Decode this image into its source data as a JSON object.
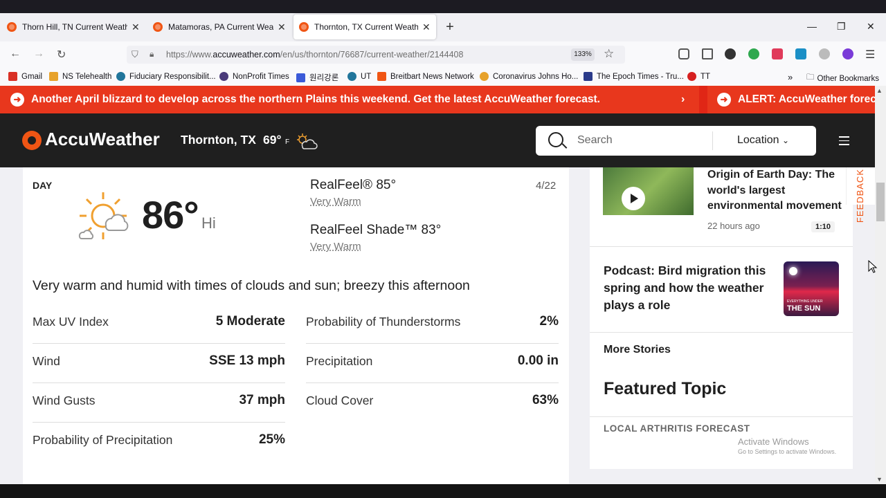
{
  "browser": {
    "tabs": [
      {
        "title": "Thorn Hill, TN Current Weather"
      },
      {
        "title": "Matamoras, PA Current Weather"
      },
      {
        "title": "Thornton, TX Current Weather | AccuWeather"
      }
    ],
    "url_prefix": "https://www.",
    "url_domain": "accuweather.com",
    "url_path": "/en/us/thornton/76687/current-weather/2144408",
    "zoom": "133%",
    "bookmarks": [
      "Gmail",
      "NS Telehealth",
      "Fiduciary Responsibilit...",
      "NonProfit Times",
      "원리강론",
      "UT",
      "Breitbart News Network",
      "Coronavirus Johns Ho...",
      "The Epoch Times - Tru...",
      "TT"
    ],
    "other_bookmarks": "Other Bookmarks"
  },
  "alerts": {
    "primary": "Another April blizzard to develop across the northern Plains this weekend. Get the latest AccuWeather forecast.",
    "secondary": "ALERT: AccuWeather foreca"
  },
  "header": {
    "logo": "AccuWeather",
    "location": "Thornton, TX",
    "temp": "69°",
    "unit": "F",
    "search_placeholder": "Search",
    "location_button": "Location"
  },
  "day": {
    "label": "DAY",
    "temp": "86°",
    "hi": "Hi",
    "realfeel": "RealFeel® 85°",
    "realfeel_phrase": "Very Warm",
    "realfeel_shade": "RealFeel Shade™ 83°",
    "realfeel_shade_phrase": "Very Warm",
    "date": "4/22",
    "phrase": "Very warm and humid with times of clouds and sun; breezy this afternoon",
    "left": [
      {
        "k": "Max UV Index",
        "v": "5 Moderate"
      },
      {
        "k": "Wind",
        "v": "SSE 13 mph"
      },
      {
        "k": "Wind Gusts",
        "v": "37 mph"
      },
      {
        "k": "Probability of Precipitation",
        "v": "25%"
      }
    ],
    "right": [
      {
        "k": "Probability of Thunderstorms",
        "v": "2%"
      },
      {
        "k": "Precipitation",
        "v": "0.00 in"
      },
      {
        "k": "Cloud Cover",
        "v": "63%"
      }
    ]
  },
  "sidebar": {
    "story1_title": "Origin of Earth Day: The world's largest environmental movement",
    "story1_time": "22 hours ago",
    "story1_duration": "1:10",
    "story2_title": "Podcast: Bird migration this spring and how the weather plays a role",
    "story2_thumb_small": "EVERYTHING UNDER",
    "story2_thumb_big": "THE SUN",
    "more_stories": "More Stories",
    "featured": "Featured Topic",
    "local": "LOCAL ARTHRITIS FORECAST"
  },
  "feedback": "FEEDBACK",
  "watermark": {
    "line1": "Activate Windows",
    "line2": "Go to Settings to activate Windows."
  }
}
